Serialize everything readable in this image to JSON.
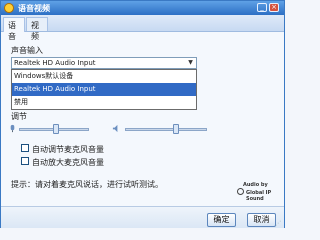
{
  "window": {
    "title": "语音视频"
  },
  "tabs": [
    {
      "label": "语音"
    },
    {
      "label": "视频"
    }
  ],
  "voice_input": {
    "section_label": "声音输入",
    "selected": "Realtek HD Audio Input",
    "options": [
      {
        "label": "Windows默认设备"
      },
      {
        "label": "Realtek HD Audio Input"
      },
      {
        "label": "禁用"
      }
    ]
  },
  "adjust": {
    "label": "调节",
    "options": [
      {
        "label": "自动调节麦克风音量"
      },
      {
        "label": "自动放大麦克风音量"
      }
    ]
  },
  "hint": "提示：请对着麦克风说话，进行试听测试。",
  "brand": {
    "audio_by": "Audio by",
    "company": "Global IP Sound"
  },
  "footer": {
    "ok_label": "确定",
    "cancel_label": "取消"
  }
}
